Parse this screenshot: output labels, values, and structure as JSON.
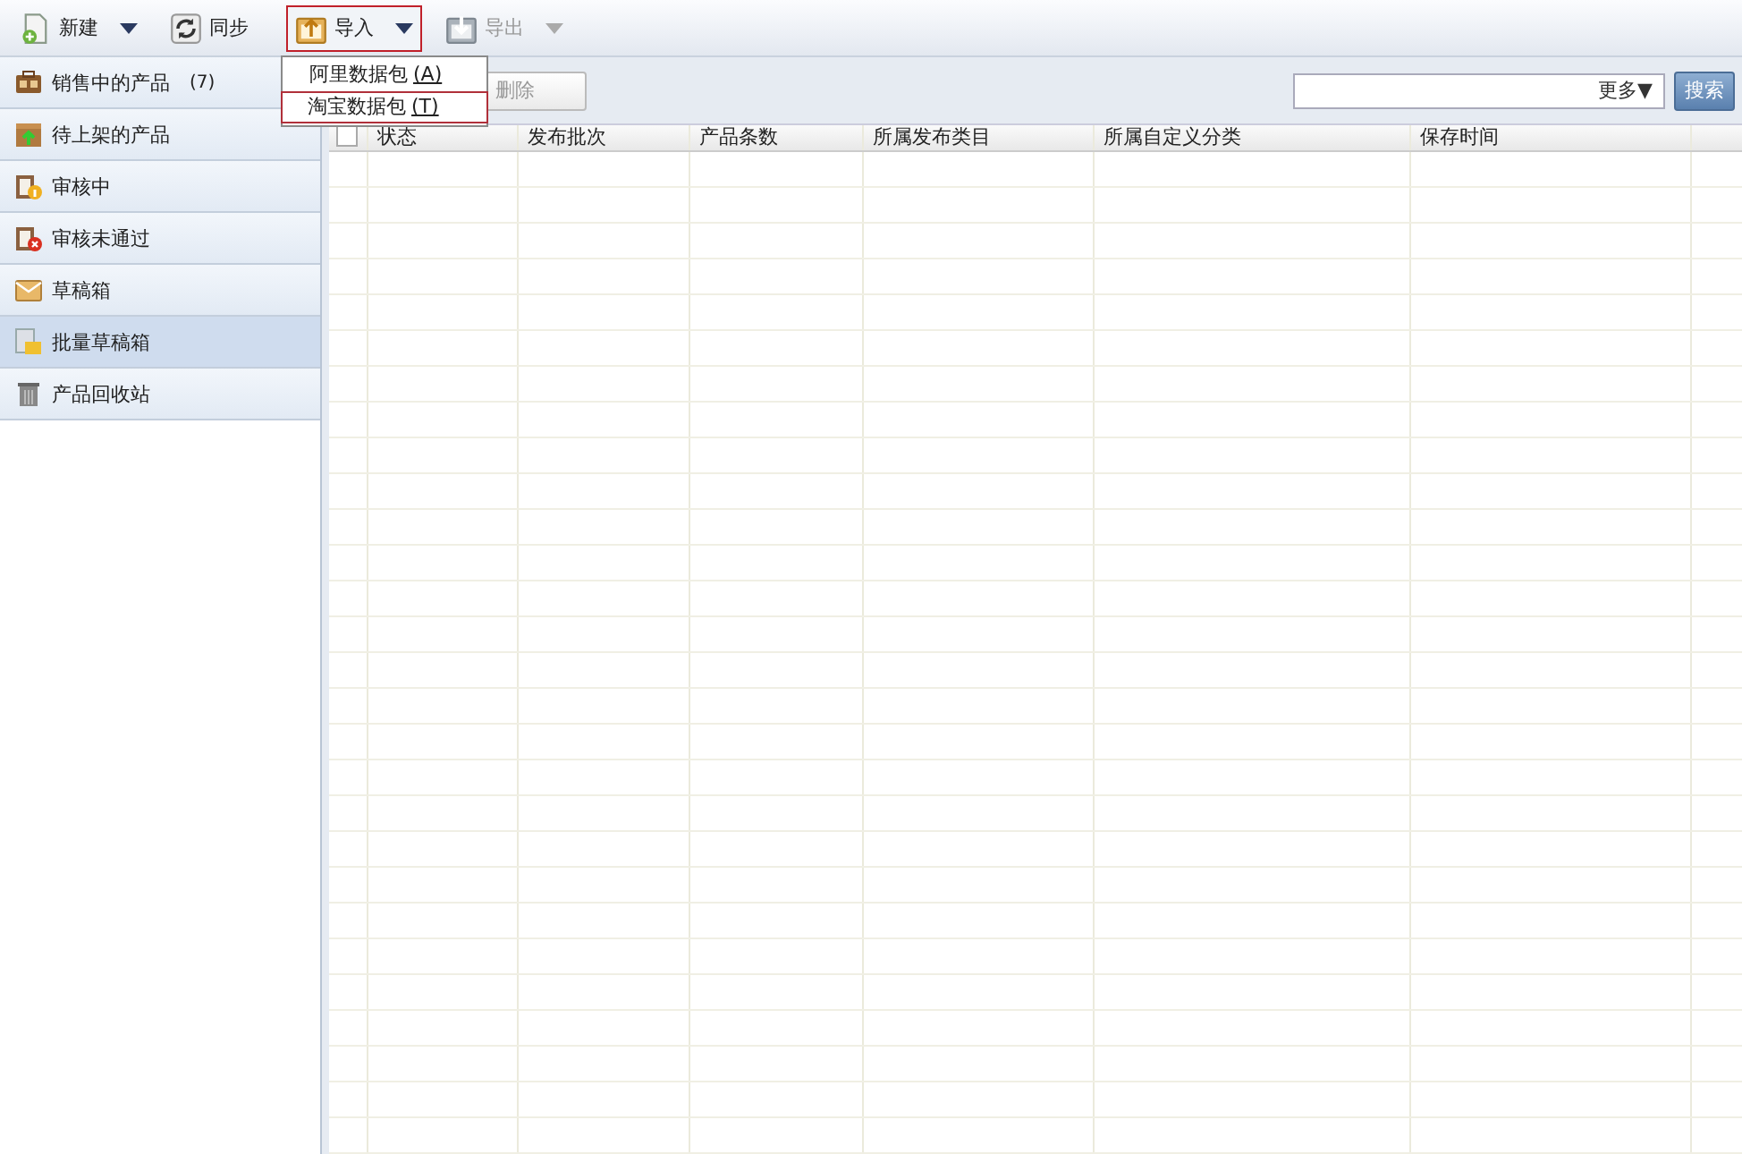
{
  "toolbar": [
    {
      "label": "新建",
      "kind": "new",
      "dropdown": true,
      "disabled": false,
      "highlighted": false
    },
    {
      "label": "同步",
      "kind": "sync",
      "dropdown": false,
      "disabled": false,
      "highlighted": false
    },
    {
      "label": "导入",
      "kind": "import",
      "dropdown": true,
      "disabled": false,
      "highlighted": true
    },
    {
      "label": "导出",
      "kind": "export",
      "dropdown": true,
      "disabled": true,
      "highlighted": false
    }
  ],
  "import_menu": [
    {
      "label": "阿里数据包",
      "key": "(A)",
      "selected": false
    },
    {
      "label": "淘宝数据包",
      "key": "(T)",
      "selected": true
    }
  ],
  "sidebar": {
    "items": [
      {
        "label": "销售中的产品",
        "count": "(7)",
        "kind": "case",
        "selected": false
      },
      {
        "label": "待上架的产品",
        "kind": "shelf",
        "selected": false
      },
      {
        "label": "审核中",
        "kind": "review",
        "selected": false
      },
      {
        "label": "审核未通过",
        "kind": "rejected",
        "selected": false
      },
      {
        "label": "草稿箱",
        "kind": "draft",
        "selected": false
      },
      {
        "label": "批量草稿箱",
        "kind": "batch",
        "selected": true
      },
      {
        "label": "产品回收站",
        "kind": "trash",
        "selected": false
      }
    ]
  },
  "actions": {
    "delete": "删除",
    "more": "更多▼",
    "search": "搜索"
  },
  "table": {
    "select_all": {
      "checked": false
    },
    "columns": [
      "状态",
      "发布批次",
      "产品条数",
      "所属发布类目",
      "所属自定义分类",
      "保存时间"
    ]
  }
}
